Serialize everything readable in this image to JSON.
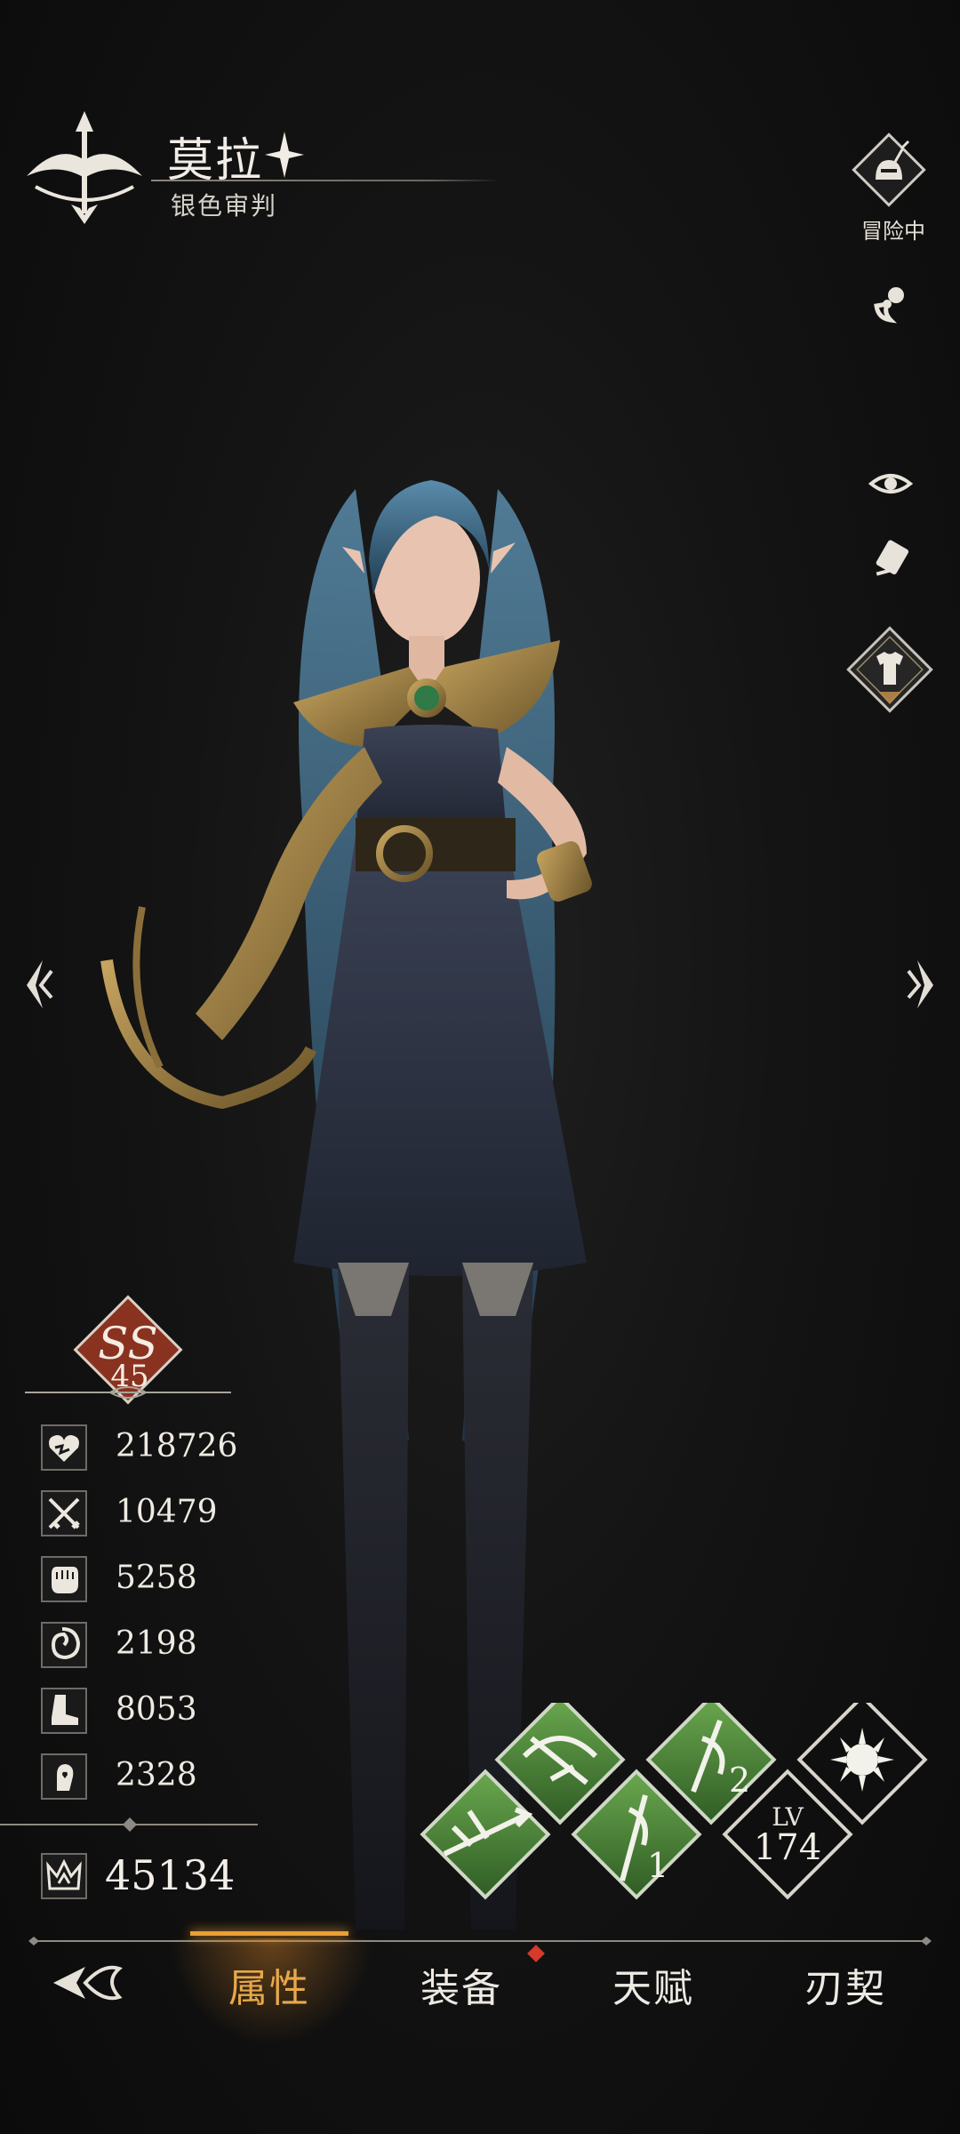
{
  "character": {
    "name": "莫拉",
    "title": "银色审判",
    "class_icon": "bow-emblem-icon",
    "grade": {
      "label": "SS",
      "level": "45"
    }
  },
  "status": {
    "label": "冒险中",
    "icon": "helmet-sword-icon"
  },
  "side_icons": [
    "pacifier-icon",
    "eye-icon",
    "card-icon",
    "outfit-icon"
  ],
  "stats": [
    {
      "icon": "heart-icon",
      "value": "218726"
    },
    {
      "icon": "crossed-swords-icon",
      "value": "10479"
    },
    {
      "icon": "fist-icon",
      "value": "5258"
    },
    {
      "icon": "swirl-icon",
      "value": "2198"
    },
    {
      "icon": "boot-icon",
      "value": "8053"
    },
    {
      "icon": "hand-heart-icon",
      "value": "2328"
    }
  ],
  "power": {
    "icon": "crown-icon",
    "value": "45134"
  },
  "skills": [
    {
      "icon": "bow-slash-skill-icon",
      "color": "#4e8a3c"
    },
    {
      "icon": "arrow-skill-icon",
      "color": "#4e8a3c"
    },
    {
      "icon": "blade-1-skill-icon",
      "label": "1",
      "color": "#4e8a3c"
    },
    {
      "icon": "blade-2-skill-icon",
      "label": "2",
      "color": "#4e8a3c"
    },
    {
      "icon": "sun-burst-skill-icon",
      "color": "#111111"
    }
  ],
  "level": {
    "label": "LV",
    "value": "174"
  },
  "tabs": [
    {
      "label": "属性",
      "active": true
    },
    {
      "label": "装备",
      "badge": true
    },
    {
      "label": "天赋"
    },
    {
      "label": "刃契"
    }
  ],
  "colors": {
    "accent": "#e9a038",
    "badge": "#d63a2a",
    "grade_bg": "#8a3220",
    "skill_green": "#4e8a3c"
  }
}
